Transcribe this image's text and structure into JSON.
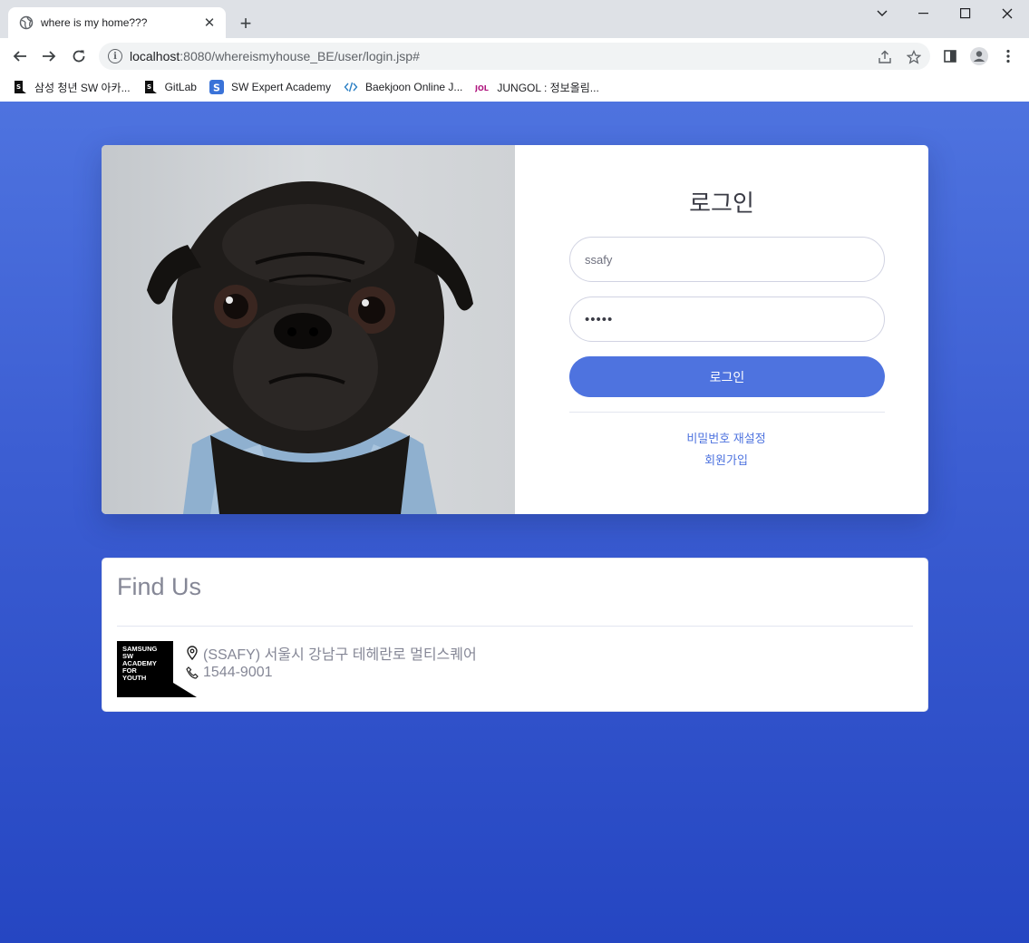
{
  "browser": {
    "tab_title": "where is my home???",
    "url_host": "localhost",
    "url_path": ":8080/whereismyhouse_BE/user/login.jsp#",
    "bookmarks": [
      {
        "label": "삼성 청년 SW 아카...",
        "icon": "ssafy-icon"
      },
      {
        "label": "GitLab",
        "icon": "ssafy-icon"
      },
      {
        "label": "SW Expert Academy",
        "icon": "swea-icon"
      },
      {
        "label": "Baekjoon Online J...",
        "icon": "code-icon"
      },
      {
        "label": "JUNGOL : 정보올림...",
        "icon": "jungol-icon"
      }
    ]
  },
  "login": {
    "title": "로그인",
    "id_value": "ssafy",
    "password_value": "•••••",
    "submit_label": "로그인",
    "reset_password_link": "비밀번호 재설정",
    "signup_link": "회원가입"
  },
  "find_us": {
    "title": "Find Us",
    "logo_text": [
      "SAMSUNG",
      "SW",
      "ACADEMY",
      "FOR",
      "YOUTH"
    ],
    "address": "(SSAFY) 서울시 강남구 테헤란로 멀티스퀘어",
    "phone": "1544-9001"
  },
  "colors": {
    "primary": "#4e73df",
    "text_muted": "#858796"
  }
}
